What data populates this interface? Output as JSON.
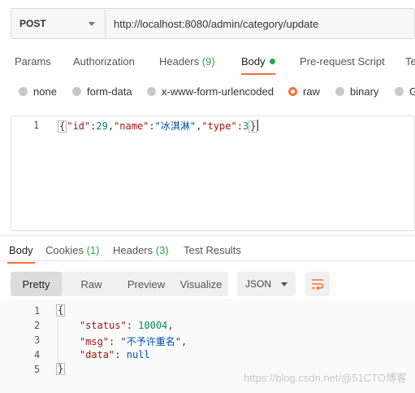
{
  "request": {
    "method": "POST",
    "url": "http://localhost:8080/admin/category/update"
  },
  "request_tabs": [
    {
      "label": "Params"
    },
    {
      "label": "Authorization"
    },
    {
      "label": "Headers",
      "count": "(9)"
    },
    {
      "label": "Body"
    },
    {
      "label": "Pre-request Script"
    },
    {
      "label": "Te"
    }
  ],
  "body_types": [
    "none",
    "form-data",
    "x-www-form-urlencoded",
    "raw",
    "binary",
    "G"
  ],
  "body_selected": "raw",
  "editor": {
    "line_number": "1",
    "brace_open": "{",
    "brace_close": "}",
    "key_id": "\"id\"",
    "val_id": "29",
    "key_name": "\"name\"",
    "val_name": "\"冰淇淋\"",
    "key_type": "\"type\"",
    "val_type": "3"
  },
  "response_tabs": [
    {
      "label": "Body"
    },
    {
      "label": "Cookies",
      "count": "(1)"
    },
    {
      "label": "Headers",
      "count": "(3)"
    },
    {
      "label": "Test Results"
    }
  ],
  "view_modes": [
    "Pretty",
    "Raw",
    "Preview",
    "Visualize"
  ],
  "format": "JSON",
  "response": {
    "line_numbers": [
      "1",
      "2",
      "3",
      "4",
      "5"
    ],
    "open": "{",
    "close": "}",
    "status_key": "\"status\"",
    "status_val": "10004",
    "msg_key": "\"msg\"",
    "msg_val": "\"不予许重名\"",
    "data_key": "\"data\"",
    "data_val": "null"
  },
  "watermark": "https://blog.csdn.net/@51CTO博客",
  "colors": {
    "accent": "#ff6c37",
    "green": "#2aa54e"
  }
}
